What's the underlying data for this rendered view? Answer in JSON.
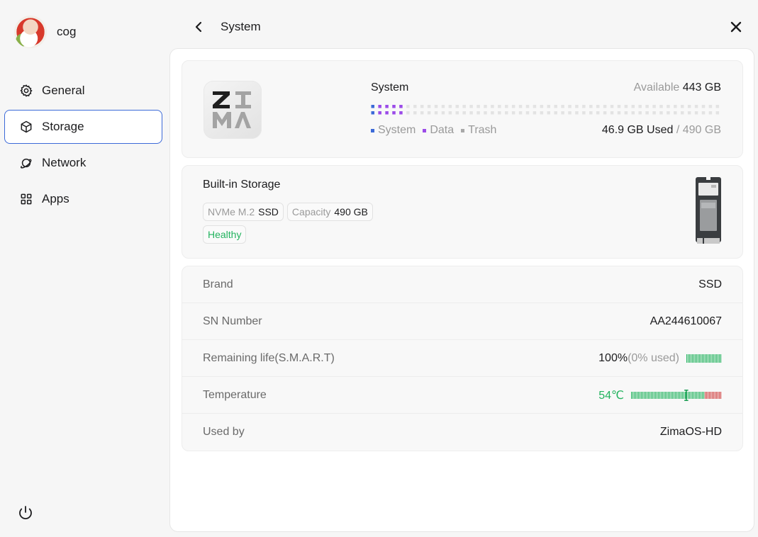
{
  "profile": {
    "name": "cog"
  },
  "nav": [
    {
      "label": "General",
      "icon": "gear-icon"
    },
    {
      "label": "Storage",
      "icon": "cube-icon",
      "active": true
    },
    {
      "label": "Network",
      "icon": "planet-icon"
    },
    {
      "label": "Apps",
      "icon": "grid-icon"
    }
  ],
  "header": {
    "title": "System"
  },
  "system_card": {
    "title": "System",
    "available_label": "Available",
    "available_value": "443 GB",
    "legend": [
      {
        "label": "System",
        "color": "#3c6ad8"
      },
      {
        "label": "Data",
        "color": "#9b4be8"
      },
      {
        "label": "Trash",
        "color": "#a8a8a8"
      }
    ],
    "used_value": "46.9 GB Used",
    "total_value": "/ 490 GB",
    "used_fraction": 0.096
  },
  "builtin_card": {
    "title": "Built-in Storage",
    "tags": [
      {
        "key": "NVMe M.2",
        "value": "SSD"
      },
      {
        "key": "Capacity",
        "value": "490 GB"
      }
    ],
    "health": "Healthy"
  },
  "details": {
    "brand_label": "Brand",
    "brand_value": "SSD",
    "sn_label": "SN Number",
    "sn_value": "AA244610067",
    "life_label": "Remaining life(S.M.A.R.T)",
    "life_value": "100%",
    "life_used": "(0% used)",
    "life_fraction": 1.0,
    "temp_label": "Temperature",
    "temp_value": "54℃",
    "temp_celsius": 54,
    "usedby_label": "Used by",
    "usedby_value": "ZimaOS-HD"
  },
  "colors": {
    "accent": "#3c6ad8",
    "healthy": "#22b35e",
    "hot": "#d04040"
  }
}
